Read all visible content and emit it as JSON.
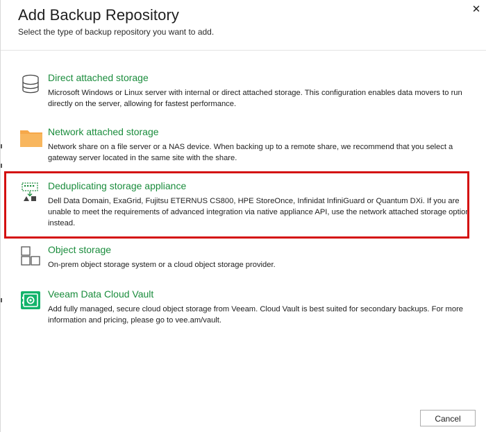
{
  "dialog": {
    "title": "Add Backup Repository",
    "subtitle": "Select the type of backup repository you want to add.",
    "close_symbol": "✕",
    "accent_color": "#1a8c3c",
    "highlight_color": "#d40f0f"
  },
  "options": [
    {
      "icon": "database-icon",
      "label": "Direct attached storage",
      "description": "Microsoft Windows or Linux server with internal or direct attached storage. This configuration enables data movers to run directly on the server, allowing for fastest performance."
    },
    {
      "icon": "folder-icon",
      "label": "Network attached storage",
      "description": "Network share on a file server or a NAS device. When backing up to a remote share, we recommend that you select a gateway server located in the same site with the share."
    },
    {
      "icon": "dedup-appliance-icon",
      "label": "Deduplicating storage appliance",
      "description": "Dell Data Domain, ExaGrid, Fujitsu ETERNUS CS800, HPE StoreOnce, Infinidat InfiniGuard or Quantum DXi. If you are unable to meet the requirements of advanced integration via native appliance API, use the network attached storage option instead.",
      "highlighted": true
    },
    {
      "icon": "object-storage-icon",
      "label": "Object storage",
      "description": "On-prem object storage system or a cloud object storage provider."
    },
    {
      "icon": "cloud-vault-icon",
      "label": "Veeam Data Cloud Vault",
      "description": "Add fully managed, secure cloud object storage from Veeam. Cloud Vault is best suited for secondary backups. For more information and pricing, please go to vee.am/vault."
    }
  ],
  "footer": {
    "cancel_label": "Cancel"
  }
}
